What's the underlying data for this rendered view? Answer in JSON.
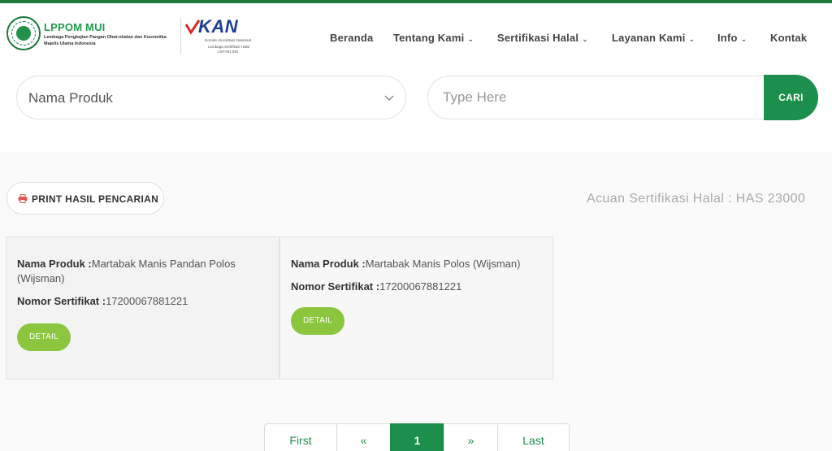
{
  "header": {
    "logo": {
      "title": "LPPOM MUI",
      "subtitle_line1": "Lembaga Pengkajian Pangan Obat-obatan dan Kosmetika",
      "subtitle_line2": "Majelis Ulama Indonesia"
    },
    "kan": {
      "title": "KAN",
      "sub1": "Komite Akreditasi Nasional",
      "sub2": "Lembaga Sertifikasi Halal",
      "sub3": "LSH-001-IDN"
    },
    "nav": [
      {
        "label": "Beranda",
        "dropdown": false
      },
      {
        "label": "Tentang Kami",
        "dropdown": true
      },
      {
        "label": "Sertifikasi Halal",
        "dropdown": true
      },
      {
        "label": "Layanan Kami",
        "dropdown": true
      },
      {
        "label": "Info",
        "dropdown": true
      },
      {
        "label": "Kontak",
        "dropdown": false
      }
    ]
  },
  "search": {
    "field_select": "Nama Produk",
    "placeholder": "Type Here",
    "button": "CARI"
  },
  "toolbar": {
    "print_label": "PRINT HASIL PENCARIAN",
    "reference": "Acuan Sertifikasi Halal : HAS 23000"
  },
  "results": [
    {
      "product_label": "Nama Produk :",
      "product_value_line1": "Martabak Manis Pandan Polos",
      "product_value_line2": "(Wijsman)",
      "cert_label": "Nomor Sertifikat :",
      "cert_value": "17200067881221",
      "detail": "DETAIL"
    },
    {
      "product_label": "Nama Produk :",
      "product_value_line1": "Martabak Manis Polos (Wijsman)",
      "cert_label": "Nomor Sertifikat :",
      "cert_value": "17200067881221",
      "detail": "DETAIL"
    }
  ],
  "pagination": {
    "first": "First",
    "prev": "«",
    "current": "1",
    "next": "»",
    "last": "Last"
  },
  "colors": {
    "brand_green": "#1c8f4c",
    "detail_green": "#8cc63f",
    "top_bar": "#1f7a3c",
    "print_icon": "#e05555"
  }
}
